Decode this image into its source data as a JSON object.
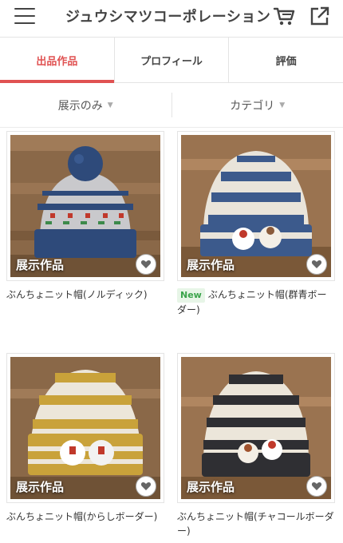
{
  "header": {
    "shop_name": "ジュウシマツコーポレーション",
    "menu_icon": "hamburger-menu-icon",
    "cart_icon": "shopping-cart-icon",
    "share_icon": "external-link-icon"
  },
  "tabs": [
    {
      "label": "出品作品",
      "active": true
    },
    {
      "label": "プロフィール",
      "active": false
    },
    {
      "label": "評価",
      "active": false
    }
  ],
  "filters": {
    "display": "展示のみ",
    "category": "カテゴリ"
  },
  "colors": {
    "accent": "#e05252",
    "new_badge": "#3aa34a"
  },
  "items": [
    {
      "title": "ぶんちょニット帽(ノルディック)",
      "label": "展示作品",
      "new": false
    },
    {
      "title": "ぶんちょニット帽(群青ボーダー)",
      "label": "展示作品",
      "new": true,
      "new_label": "New"
    },
    {
      "title": "ぶんちょニット帽(からしボーダー)",
      "label": "展示作品",
      "new": false
    },
    {
      "title": "ぶんちょニット帽(チャコールボーダー)",
      "label": "展示作品",
      "new": false
    }
  ]
}
